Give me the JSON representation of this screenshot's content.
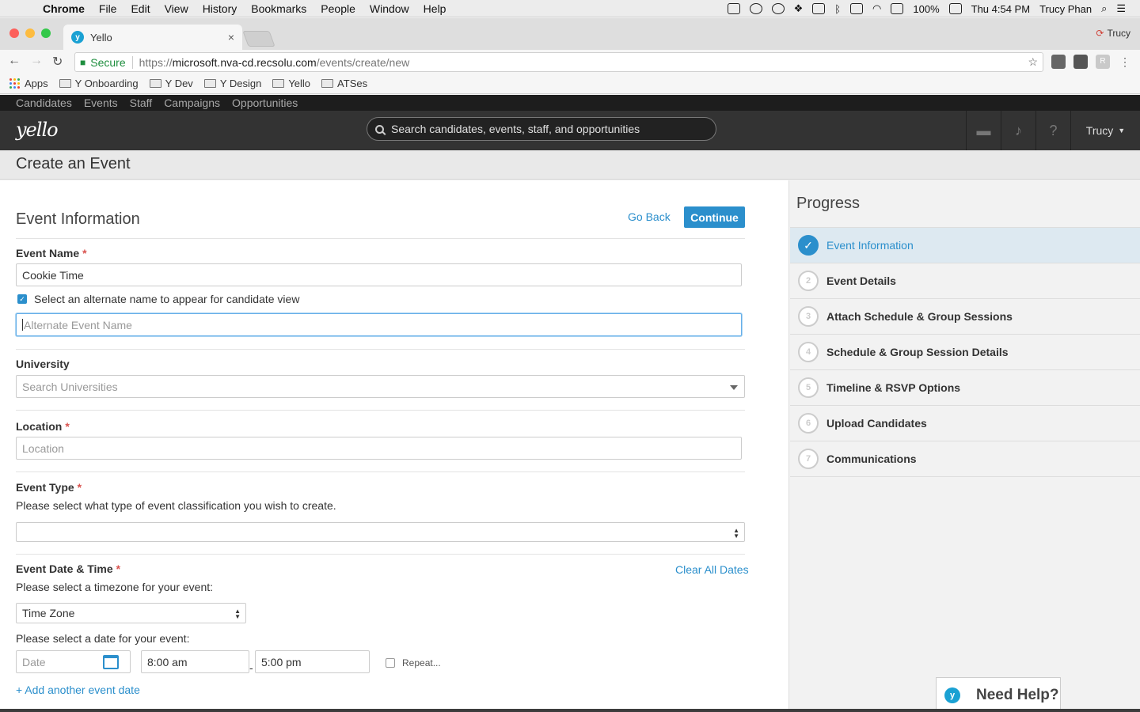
{
  "macos": {
    "menu": [
      "Chrome",
      "File",
      "Edit",
      "View",
      "History",
      "Bookmarks",
      "People",
      "Window",
      "Help"
    ],
    "battery": "100%",
    "clock": "Thu 4:54 PM",
    "user": "Trucy Phan"
  },
  "browser": {
    "tab_title": "Yello",
    "profile_name": "Trucy",
    "secure_label": "Secure",
    "url_scheme": "https://",
    "url_host": "microsoft.nva-cd.recsolu.com",
    "url_path": "/events/create/new",
    "bookmarks": [
      "Apps",
      "Y Onboarding",
      "Y Dev",
      "Y Design",
      "Yello",
      "ATSes"
    ]
  },
  "app": {
    "top_links": [
      "Candidates",
      "Events",
      "Staff",
      "Campaigns",
      "Opportunities"
    ],
    "logo": "yello",
    "search_placeholder": "Search candidates, events, staff, and opportunities",
    "user_menu": "Trucy",
    "page_title": "Create an Event"
  },
  "form": {
    "section_title": "Event Information",
    "go_back": "Go Back",
    "continue": "Continue",
    "event_name_label": "Event Name",
    "event_name_value": "Cookie Time",
    "alt_name_checkbox": "Select an alternate name to appear for candidate view",
    "alt_name_placeholder": "Alternate Event Name",
    "university_label": "University",
    "university_placeholder": "Search Universities",
    "location_label": "Location",
    "location_placeholder": "Location",
    "event_type_label": "Event Type",
    "event_type_help": "Please select what type of event classification you wish to create.",
    "event_type_value": "",
    "date_time_label": "Event Date & Time",
    "clear_all_dates": "Clear All Dates",
    "timezone_help": "Please select a timezone for your event:",
    "timezone_value": "Time Zone",
    "date_help": "Please select a date for your event:",
    "date_placeholder": "Date",
    "start_time": "8:00 am",
    "end_time": "5:00 pm",
    "repeat_label": "Repeat...",
    "add_another_date": "+ Add another event date"
  },
  "progress": {
    "title": "Progress",
    "steps": [
      {
        "num": "✓",
        "label": "Event Information"
      },
      {
        "num": "2",
        "label": "Event Details"
      },
      {
        "num": "3",
        "label": "Attach Schedule & Group Sessions"
      },
      {
        "num": "4",
        "label": "Schedule & Group Session Details"
      },
      {
        "num": "5",
        "label": "Timeline & RSVP Options"
      },
      {
        "num": "6",
        "label": "Upload Candidates"
      },
      {
        "num": "7",
        "label": "Communications"
      }
    ]
  },
  "help_widget": "Need Help?",
  "colors": {
    "accent": "#2b8fcc",
    "required": "#d9534f",
    "header_bg": "#333333"
  }
}
